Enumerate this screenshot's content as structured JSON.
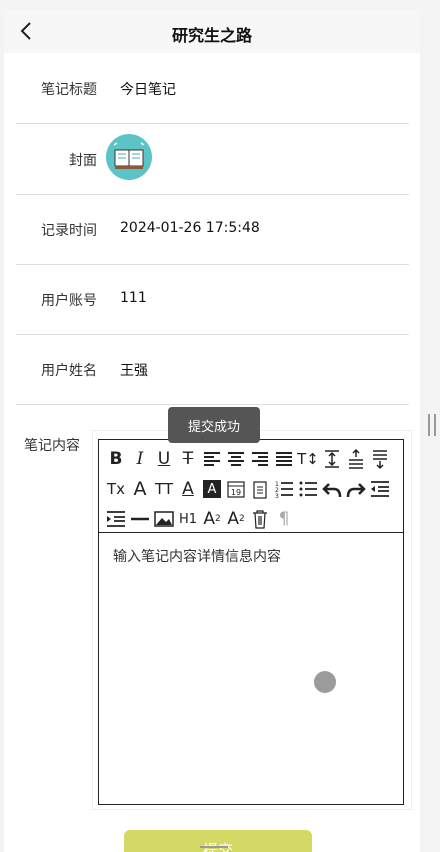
{
  "navbar": {
    "title": "研究生之路"
  },
  "form": {
    "title_label": "笔记标题",
    "title_value": "今日笔记",
    "cover_label": "封面",
    "time_label": "记录时间",
    "time_value": "2024-01-26 17:5:48",
    "account_label": "用户账号",
    "account_value": "111",
    "name_label": "用户姓名",
    "name_value": "王强",
    "content_label": "笔记内容",
    "content_placeholder": "输入笔记内容详情信息内容"
  },
  "toolbar": {
    "h1_label": "H1",
    "date_label": "19"
  },
  "toast": {
    "text": "提交成功"
  },
  "submit_label": "提交",
  "colors": {
    "submit": "#d4d864",
    "toast": "#555555",
    "cover": "#5cc4c7"
  }
}
